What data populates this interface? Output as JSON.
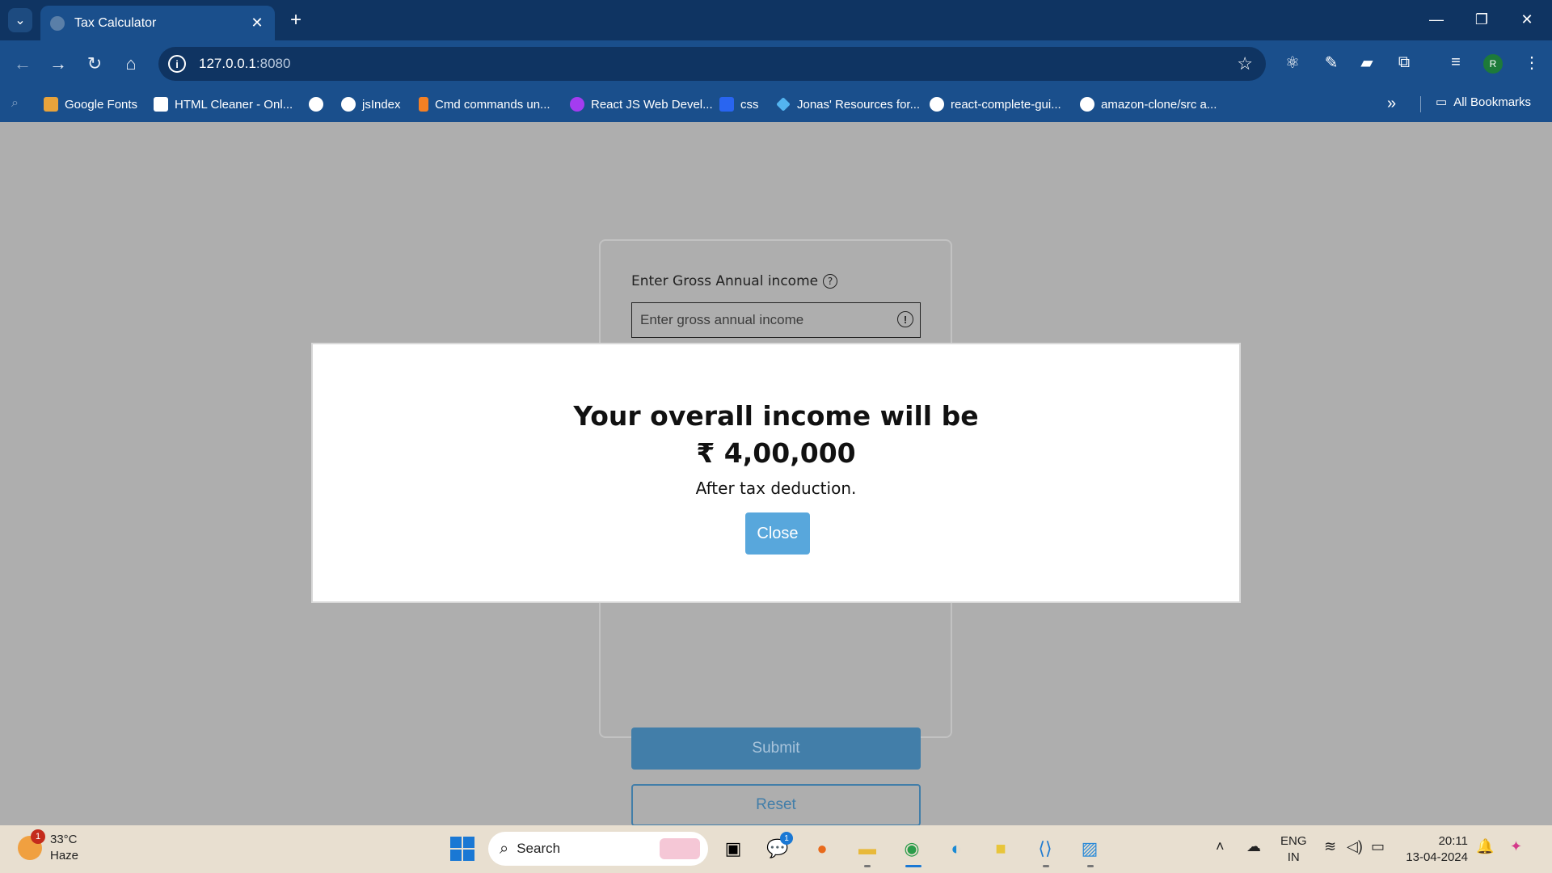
{
  "browser": {
    "tab_title": "Tax Calculator",
    "url_host": "127.0.0.1",
    "url_port": ":8080",
    "profile_initial": "R"
  },
  "bookmarks": [
    {
      "label": "Google Fonts",
      "icon": "google-fonts-icon",
      "color": "#e8a33b"
    },
    {
      "label": "HTML Cleaner - Onl...",
      "icon": "html-cleaner-icon",
      "color": "#ffffff"
    },
    {
      "label": "",
      "icon": "info-badge-icon",
      "color": "#ffffff"
    },
    {
      "label": "jsIndex",
      "icon": "globe-icon",
      "color": "#ffffff"
    },
    {
      "label": "Cmd commands un...",
      "icon": "stack-icon",
      "color": "#f48024"
    },
    {
      "label": "React JS Web Devel...",
      "icon": "react-course-icon",
      "color": "#a43cf0"
    },
    {
      "label": "css",
      "icon": "css-icon",
      "color": "#2965f1"
    },
    {
      "label": "Jonas' Resources for...",
      "icon": "diamond-icon",
      "color": "#53b4f0"
    },
    {
      "label": "react-complete-gui...",
      "icon": "github-icon",
      "color": "#ffffff"
    },
    {
      "label": "amazon-clone/src a...",
      "icon": "github-icon",
      "color": "#ffffff"
    }
  ],
  "all_bookmarks_label": "All Bookmarks",
  "form": {
    "label": "Enter Gross Annual income",
    "input_placeholder": "Enter gross annual income",
    "submit_label": "Submit",
    "reset_label": "Reset"
  },
  "modal": {
    "title": "Your overall income will be",
    "amount": "₹ 4,00,000",
    "subtitle": "After tax deduction.",
    "close_label": "Close"
  },
  "taskbar": {
    "weather_badge": "1",
    "temperature": "33°C",
    "condition": "Haze",
    "search_placeholder": "Search",
    "chat_badge": "1",
    "language_line1": "ENG",
    "language_line2": "IN",
    "time": "20:11",
    "date": "13-04-2024"
  },
  "colors": {
    "accent": "#58a7dc",
    "submit": "#427ea9",
    "chrome_dark": "#0f3462",
    "chrome": "#1a4f8c"
  }
}
